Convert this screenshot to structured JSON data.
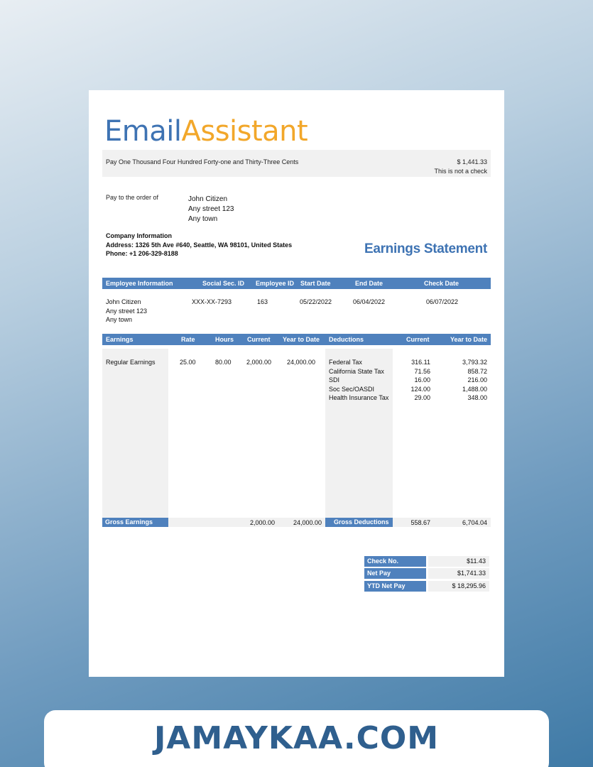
{
  "logo": {
    "part1": "Email",
    "part2": "Assistant"
  },
  "pay": {
    "words": "Pay One Thousand Four Hundred Forty-one and Thirty-Three Cents",
    "amount": "$ 1,441.33",
    "note": "This is not a check"
  },
  "payee": {
    "label": "Pay to the order of",
    "name": "John Citizen",
    "street": "Any street 123",
    "town": "Any town"
  },
  "company": {
    "heading": "Company Information",
    "address": "Address: 1326 5th Ave #640, Seattle, WA 98101, United States",
    "phone": "Phone: +1 206-329-8188"
  },
  "statement_title": "Earnings Statement",
  "employee": {
    "headers": [
      "Employee Information",
      "Social Sec. ID",
      "Employee ID",
      "Start Date",
      "End Date",
      "Check Date"
    ],
    "name": "John Citizen",
    "street": "Any street 123",
    "town": "Any town",
    "ssn": "XXX-XX-7293",
    "id": "163",
    "start": "05/22/2022",
    "end": "06/04/2022",
    "check": "06/07/2022"
  },
  "earnings": {
    "headers": [
      "Earnings",
      "Rate",
      "Hours",
      "Current",
      "Year to Date",
      "Deductions",
      "Current",
      "Year to Date"
    ],
    "row": {
      "label": "Regular Earnings",
      "rate": "25.00",
      "hours": "80.00",
      "current": "2,000.00",
      "ytd": "24,000.00"
    },
    "deductions": [
      {
        "label": "Federal Tax",
        "current": "316.11",
        "ytd": "3,793.32"
      },
      {
        "label": "California State Tax",
        "current": "71.56",
        "ytd": "858.72"
      },
      {
        "label": "SDI",
        "current": "16.00",
        "ytd": "216.00"
      },
      {
        "label": "Soc Sec/OASDI",
        "current": "124.00",
        "ytd": "1,488.00"
      },
      {
        "label": "Health Insurance Tax",
        "current": "29.00",
        "ytd": "348.00"
      }
    ],
    "gross_earnings_label": "Gross Earnings",
    "gross_current": "2,000.00",
    "gross_ytd": "24,000.00",
    "gross_deductions_label": "Gross Deductions",
    "gross_ded_current": "558.67",
    "gross_ded_ytd": "6,704.04"
  },
  "summary": [
    {
      "label": "Check No.",
      "value": "$11.43"
    },
    {
      "label": "Net Pay",
      "value": "$1,741.33"
    },
    {
      "label": "YTD Net Pay",
      "value": "$ 18,295.96"
    }
  ],
  "footer": "JAMAYKAA.COM"
}
